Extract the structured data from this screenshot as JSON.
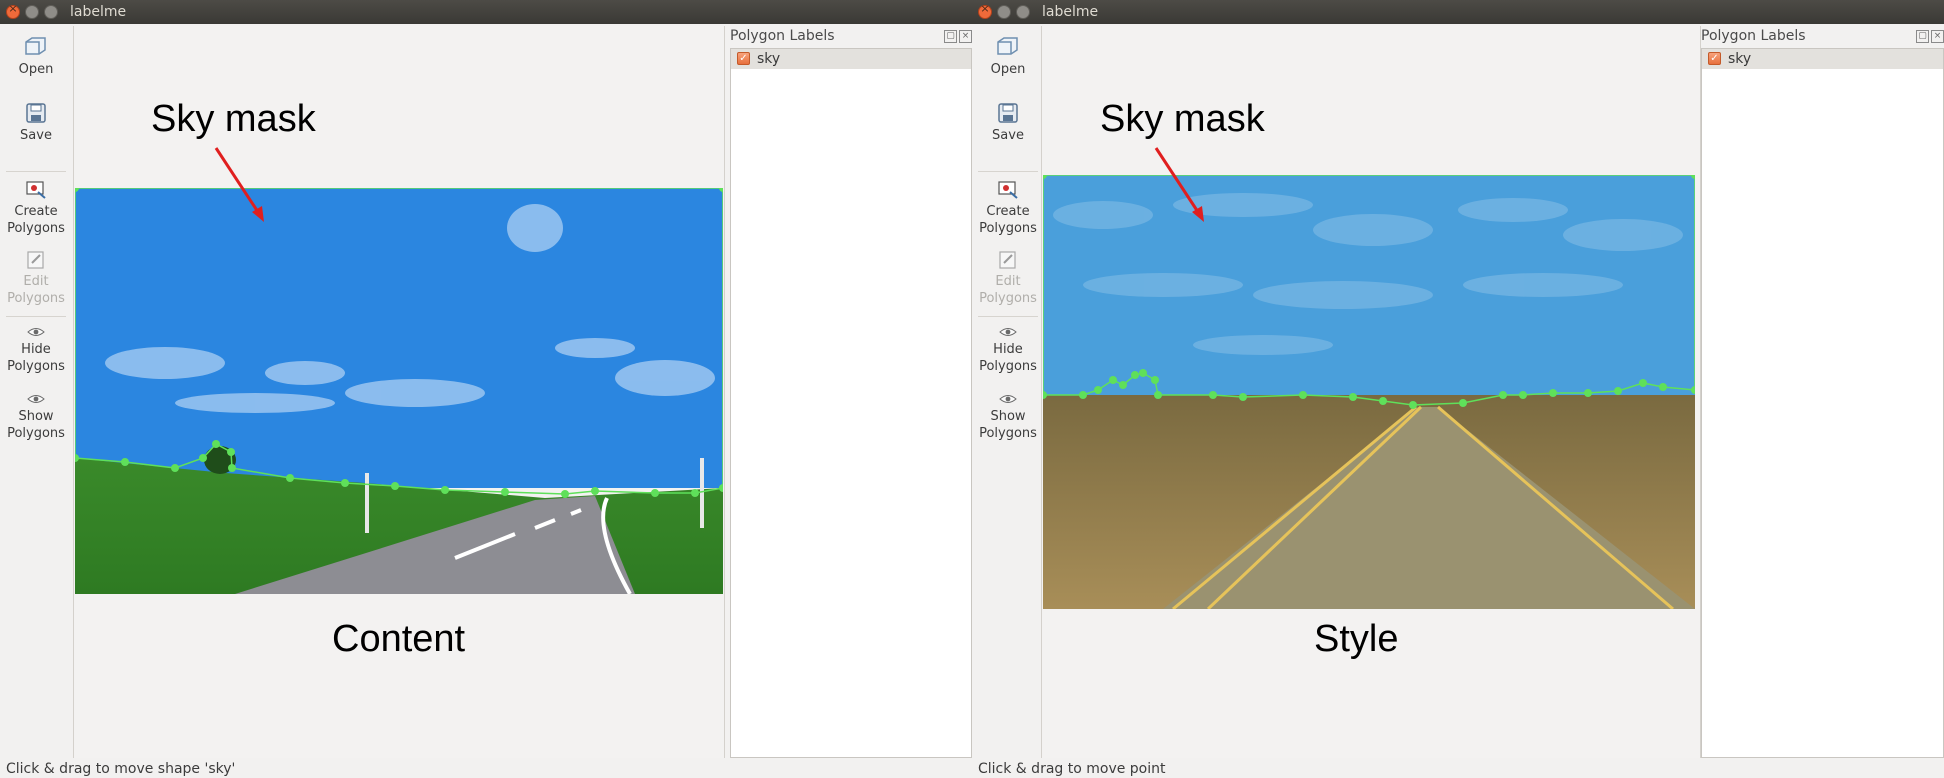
{
  "left_window": {
    "title": "labelme",
    "toolbar": {
      "open": "Open",
      "save": "Save",
      "create_polygons": [
        "Create",
        "Polygons"
      ],
      "edit_polygons": [
        "Edit",
        "Polygons"
      ],
      "hide_polygons": [
        "Hide",
        "Polygons"
      ],
      "show_polygons": [
        "Show",
        "Polygons"
      ]
    },
    "annotation": "Sky mask",
    "caption": "Content",
    "dock": {
      "title": "Polygon Labels",
      "labels": [
        "sky"
      ]
    },
    "status": "Click & drag to move shape 'sky'"
  },
  "right_window": {
    "title": "labelme",
    "toolbar": {
      "open": "Open",
      "save": "Save",
      "create_polygons": [
        "Create",
        "Polygons"
      ],
      "edit_polygons": [
        "Edit",
        "Polygons"
      ],
      "hide_polygons": [
        "Hide",
        "Polygons"
      ],
      "show_polygons": [
        "Show",
        "Polygons"
      ]
    },
    "annotation": "Sky mask",
    "caption": "Style",
    "dock": {
      "title": "Polygon Labels",
      "labels": [
        "sky"
      ]
    },
    "status": "Click & drag to move point"
  },
  "colors": {
    "sky_mask_content": "#2b86e0",
    "sky_mask_style": "#4a9fdb",
    "polygon_vertex": "#5fe05a",
    "arrow": "#e01f1f",
    "close_button": "#ef6a3a"
  },
  "icons": [
    "open-icon",
    "save-icon",
    "create-polygons-icon",
    "edit-polygons-icon",
    "eye-icon"
  ]
}
